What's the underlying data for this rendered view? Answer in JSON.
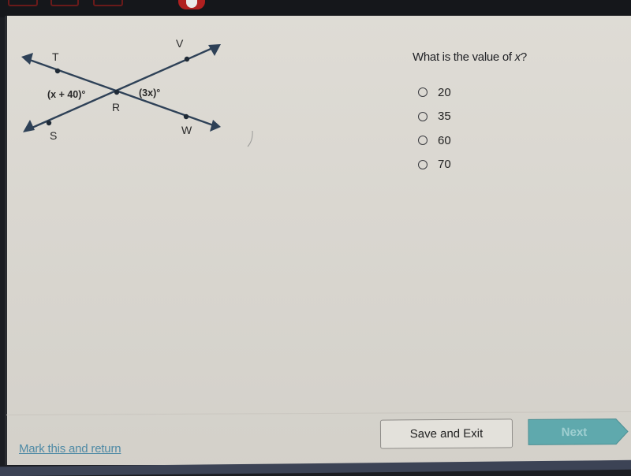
{
  "question": {
    "prefix": "What is the value of ",
    "variable": "x",
    "suffix": "?"
  },
  "diagram": {
    "points": {
      "T": "T",
      "V": "V",
      "R": "R",
      "S": "S",
      "W": "W"
    },
    "angle_left": "(x + 40)°",
    "angle_right": "(3x)°"
  },
  "options": [
    {
      "label": "20",
      "selected": false
    },
    {
      "label": "35",
      "selected": false
    },
    {
      "label": "60",
      "selected": false
    },
    {
      "label": "70",
      "selected": false
    }
  ],
  "footer": {
    "mark_link": "Mark this and return",
    "save_button": "Save and Exit",
    "next_button": "Next"
  },
  "colors": {
    "line": "#2e4157",
    "next_bg": "#5fa9ad",
    "link": "#4f8aa5"
  }
}
